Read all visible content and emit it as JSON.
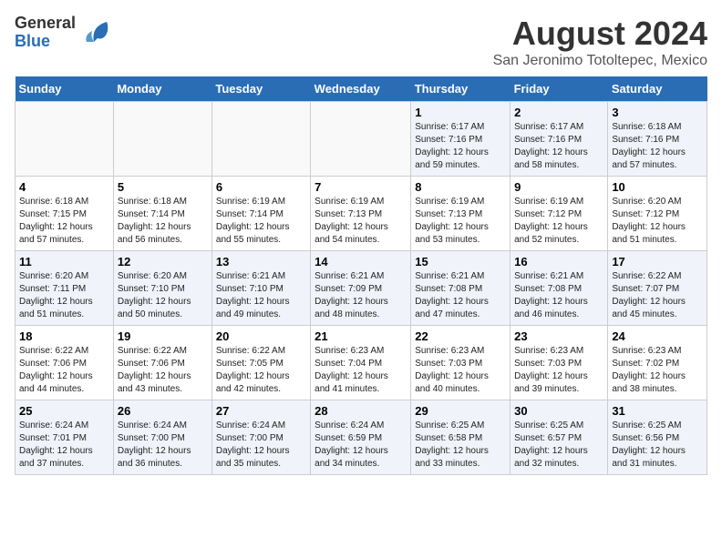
{
  "logo": {
    "general": "General",
    "blue": "Blue"
  },
  "title": "August 2024",
  "subtitle": "San Jeronimo Totoltepec, Mexico",
  "days_of_week": [
    "Sunday",
    "Monday",
    "Tuesday",
    "Wednesday",
    "Thursday",
    "Friday",
    "Saturday"
  ],
  "weeks": [
    [
      {
        "day": "",
        "info": ""
      },
      {
        "day": "",
        "info": ""
      },
      {
        "day": "",
        "info": ""
      },
      {
        "day": "",
        "info": ""
      },
      {
        "day": "1",
        "info": "Sunrise: 6:17 AM\nSunset: 7:16 PM\nDaylight: 12 hours\nand 59 minutes."
      },
      {
        "day": "2",
        "info": "Sunrise: 6:17 AM\nSunset: 7:16 PM\nDaylight: 12 hours\nand 58 minutes."
      },
      {
        "day": "3",
        "info": "Sunrise: 6:18 AM\nSunset: 7:16 PM\nDaylight: 12 hours\nand 57 minutes."
      }
    ],
    [
      {
        "day": "4",
        "info": "Sunrise: 6:18 AM\nSunset: 7:15 PM\nDaylight: 12 hours\nand 57 minutes."
      },
      {
        "day": "5",
        "info": "Sunrise: 6:18 AM\nSunset: 7:14 PM\nDaylight: 12 hours\nand 56 minutes."
      },
      {
        "day": "6",
        "info": "Sunrise: 6:19 AM\nSunset: 7:14 PM\nDaylight: 12 hours\nand 55 minutes."
      },
      {
        "day": "7",
        "info": "Sunrise: 6:19 AM\nSunset: 7:13 PM\nDaylight: 12 hours\nand 54 minutes."
      },
      {
        "day": "8",
        "info": "Sunrise: 6:19 AM\nSunset: 7:13 PM\nDaylight: 12 hours\nand 53 minutes."
      },
      {
        "day": "9",
        "info": "Sunrise: 6:19 AM\nSunset: 7:12 PM\nDaylight: 12 hours\nand 52 minutes."
      },
      {
        "day": "10",
        "info": "Sunrise: 6:20 AM\nSunset: 7:12 PM\nDaylight: 12 hours\nand 51 minutes."
      }
    ],
    [
      {
        "day": "11",
        "info": "Sunrise: 6:20 AM\nSunset: 7:11 PM\nDaylight: 12 hours\nand 51 minutes."
      },
      {
        "day": "12",
        "info": "Sunrise: 6:20 AM\nSunset: 7:10 PM\nDaylight: 12 hours\nand 50 minutes."
      },
      {
        "day": "13",
        "info": "Sunrise: 6:21 AM\nSunset: 7:10 PM\nDaylight: 12 hours\nand 49 minutes."
      },
      {
        "day": "14",
        "info": "Sunrise: 6:21 AM\nSunset: 7:09 PM\nDaylight: 12 hours\nand 48 minutes."
      },
      {
        "day": "15",
        "info": "Sunrise: 6:21 AM\nSunset: 7:08 PM\nDaylight: 12 hours\nand 47 minutes."
      },
      {
        "day": "16",
        "info": "Sunrise: 6:21 AM\nSunset: 7:08 PM\nDaylight: 12 hours\nand 46 minutes."
      },
      {
        "day": "17",
        "info": "Sunrise: 6:22 AM\nSunset: 7:07 PM\nDaylight: 12 hours\nand 45 minutes."
      }
    ],
    [
      {
        "day": "18",
        "info": "Sunrise: 6:22 AM\nSunset: 7:06 PM\nDaylight: 12 hours\nand 44 minutes."
      },
      {
        "day": "19",
        "info": "Sunrise: 6:22 AM\nSunset: 7:06 PM\nDaylight: 12 hours\nand 43 minutes."
      },
      {
        "day": "20",
        "info": "Sunrise: 6:22 AM\nSunset: 7:05 PM\nDaylight: 12 hours\nand 42 minutes."
      },
      {
        "day": "21",
        "info": "Sunrise: 6:23 AM\nSunset: 7:04 PM\nDaylight: 12 hours\nand 41 minutes."
      },
      {
        "day": "22",
        "info": "Sunrise: 6:23 AM\nSunset: 7:03 PM\nDaylight: 12 hours\nand 40 minutes."
      },
      {
        "day": "23",
        "info": "Sunrise: 6:23 AM\nSunset: 7:03 PM\nDaylight: 12 hours\nand 39 minutes."
      },
      {
        "day": "24",
        "info": "Sunrise: 6:23 AM\nSunset: 7:02 PM\nDaylight: 12 hours\nand 38 minutes."
      }
    ],
    [
      {
        "day": "25",
        "info": "Sunrise: 6:24 AM\nSunset: 7:01 PM\nDaylight: 12 hours\nand 37 minutes."
      },
      {
        "day": "26",
        "info": "Sunrise: 6:24 AM\nSunset: 7:00 PM\nDaylight: 12 hours\nand 36 minutes."
      },
      {
        "day": "27",
        "info": "Sunrise: 6:24 AM\nSunset: 7:00 PM\nDaylight: 12 hours\nand 35 minutes."
      },
      {
        "day": "28",
        "info": "Sunrise: 6:24 AM\nSunset: 6:59 PM\nDaylight: 12 hours\nand 34 minutes."
      },
      {
        "day": "29",
        "info": "Sunrise: 6:25 AM\nSunset: 6:58 PM\nDaylight: 12 hours\nand 33 minutes."
      },
      {
        "day": "30",
        "info": "Sunrise: 6:25 AM\nSunset: 6:57 PM\nDaylight: 12 hours\nand 32 minutes."
      },
      {
        "day": "31",
        "info": "Sunrise: 6:25 AM\nSunset: 6:56 PM\nDaylight: 12 hours\nand 31 minutes."
      }
    ]
  ]
}
